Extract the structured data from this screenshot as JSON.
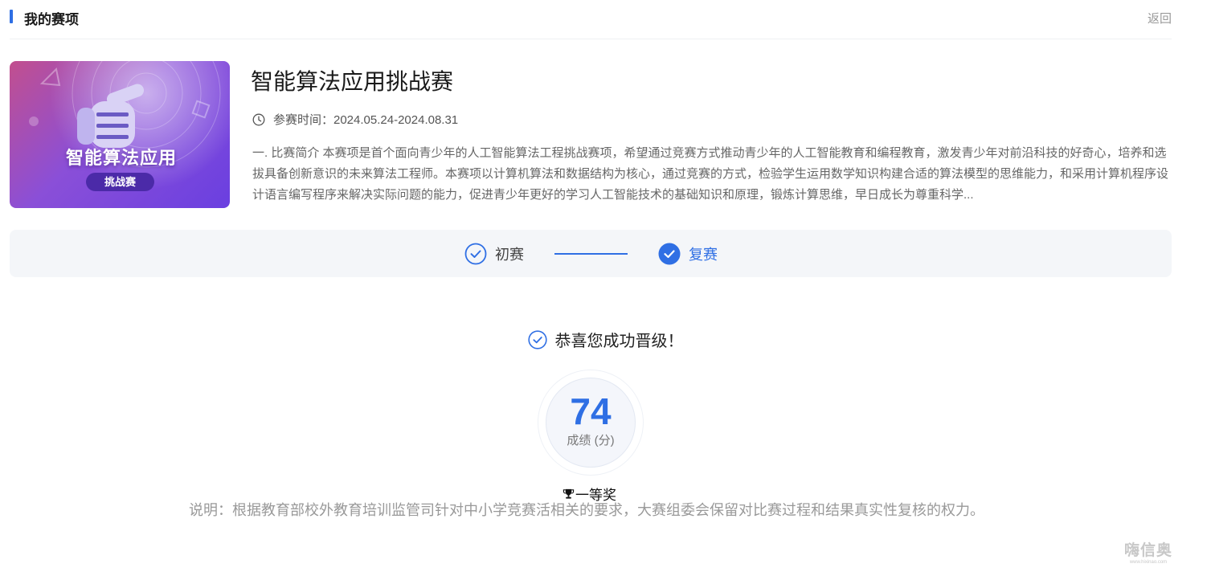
{
  "header": {
    "title": "我的赛项",
    "back_label": "返回"
  },
  "competition": {
    "cover_title": "智能算法应用",
    "cover_badge": "挑战赛",
    "title": "智能算法应用挑战赛",
    "time_label": "参赛时间：2024.05.24-2024.08.31",
    "description": "一. 比赛简介 本赛项是首个面向青少年的人工智能算法工程挑战赛项，希望通过竞赛方式推动青少年的人工智能教育和编程教育，激发青少年对前沿科技的好奇心，培养和选拔具备创新意识的未来算法工程师。本赛项以计算机算法和数据结构为核心，通过竞赛的方式，检验学生运用数学知识构建合适的算法模型的思维能力，和采用计算机程序设计语言编写程序来解决实际问题的能力，促进青少年更好的学习人工智能技术的基础知识和原理，锻炼计算思维，早日成长为尊重科学..."
  },
  "steps": [
    {
      "label": "初赛",
      "status": "completed"
    },
    {
      "label": "复赛",
      "status": "current"
    }
  ],
  "result": {
    "message": "恭喜您成功晋级！",
    "score": "74",
    "score_label": "成绩 (分)",
    "award": "一等奖",
    "note": "说明：根据教育部校外教育培训监管司针对中小学竞赛活相关的要求，大赛组委会保留对比赛过程和结果真实性复核的权力。"
  },
  "watermark": {
    "main": "嗨信奥",
    "sub": "www.hixinao.com"
  },
  "colors": {
    "accent": "#2f6fe4",
    "step_bg": "#f4f6f9"
  }
}
